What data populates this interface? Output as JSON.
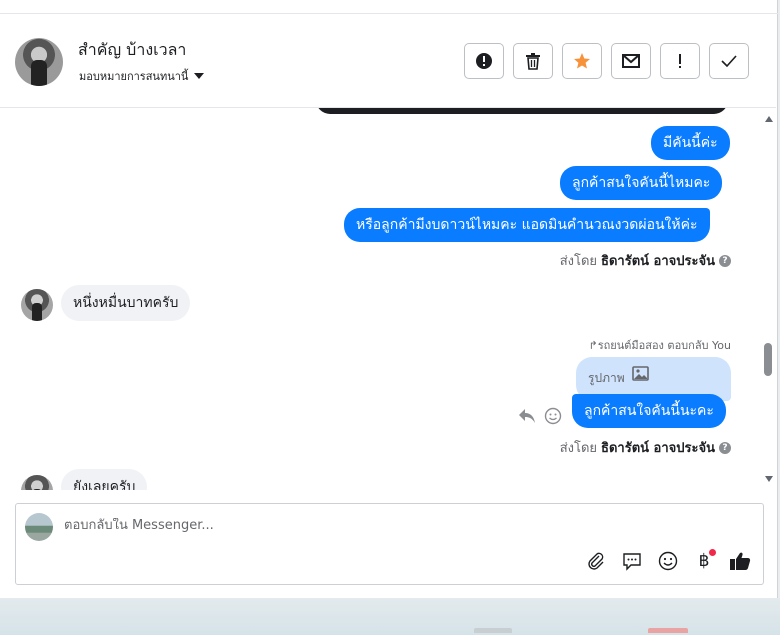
{
  "header": {
    "contact_name": "สำคัญ บ้างเวลา",
    "assign_label": "มอบหมายการสนทนานี้",
    "actions": [
      {
        "name": "report-button",
        "icon": "exclamation-circle-icon"
      },
      {
        "name": "delete-button",
        "icon": "trash-icon"
      },
      {
        "name": "star-button",
        "icon": "star-icon",
        "color": "#f7923a"
      },
      {
        "name": "mail-button",
        "icon": "envelope-icon"
      },
      {
        "name": "flag-important-button",
        "icon": "exclamation-icon"
      },
      {
        "name": "done-button",
        "icon": "check-icon"
      }
    ]
  },
  "messages": {
    "out1": "มีคันนี้ค่ะ",
    "out2": "ลูกค้าสนใจคันนี้ไหมคะ",
    "out3": "หรือลูกค้ามีงบดาวน์ไหมคะ แอดมินคำนวณงวดผ่อนให้ค่ะ",
    "sent_by_prefix": "ส่งโดย",
    "sent_by_name": "ธิดารัตน์ อาจประจัน",
    "in1": "หนึ่งหมื่นบาทครับ",
    "reply_note": "รถยนต์มือสอง ตอบกลับ You",
    "photo_label": "รูปภาพ",
    "out4": "ลูกค้าสนใจคันนี้นะคะ",
    "in2": "ยังเลยครับ"
  },
  "composer": {
    "placeholder": "ตอบกลับใน Messenger...",
    "baht_symbol": "฿"
  },
  "colors": {
    "accent": "#0a7cff",
    "incoming_bg": "#f0f2f5",
    "star": "#f7923a",
    "notification_dot": "#f02849"
  }
}
